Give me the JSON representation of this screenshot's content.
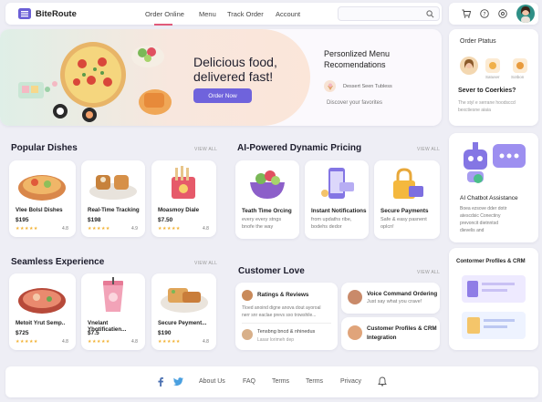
{
  "brand": {
    "name": "BiteRoute"
  },
  "nav": {
    "order_online": "Order Online",
    "menu": "Menu",
    "track_order": "Track Order",
    "account": "Account"
  },
  "hero": {
    "headline_1": "Delicious food,",
    "headline_2": "delivered fast!",
    "button": "Order Now",
    "menu_title_1": "Personlized Menu",
    "menu_title_2": "Recomendations",
    "menu_item": "Dessert Seen Tubless",
    "menu_note": "Discover your favorites"
  },
  "right_panel": {
    "orders_title": "Order Ptatus",
    "avatar_label_1": "Satuser",
    "avatar_label_2": "Sotbon",
    "question": "Sever to Coerkies?",
    "sub_1": "The styl e serrane hoodsccd",
    "sub_2": "bexctiesne aiaia"
  },
  "popular": {
    "title": "Popular Dishes",
    "view_all": "VIEW ALL",
    "items": [
      {
        "name": "Vlee Bolsl Dishes",
        "price": "$195",
        "rating": "4.8"
      },
      {
        "name": "Real-Time Tracking",
        "price": "$198",
        "rating": "4.9"
      },
      {
        "name": "Moasmoy Diale",
        "price": "$7.50",
        "rating": "4.8"
      }
    ]
  },
  "pricing": {
    "title": "AI-Powered Dynamic Pricing",
    "view_all": "VIEW ALL",
    "items": [
      {
        "name": "Teath Time Orcing",
        "desc_1": "every every stngs",
        "desc_2": "bnofe the way"
      },
      {
        "name": "Instant Notifications",
        "desc_1": "from updaths ribe,",
        "desc_2": "bodehs dedor"
      },
      {
        "name": "Secure Payments",
        "desc_1": "Safe & easy pasnent",
        "desc_2": "oplcn!"
      }
    ]
  },
  "chatbot": {
    "title": "AI Chatbot Assistance",
    "desc_1": "Boea ezsove dder dotir",
    "desc_2": "atescdsic Conectiny",
    "desc_3": "prevoncit dietnntsd",
    "desc_4": "dievelis and"
  },
  "seamless": {
    "title": "Seamless Experience",
    "view_all": "VIEW ALL",
    "items": [
      {
        "name": "Metoit Yrut Semp..",
        "price": "$725",
        "rating": "4.8"
      },
      {
        "name": "Vnelant Yhotificatien...",
        "price": "$7.5",
        "rating": "4.8"
      },
      {
        "name": "Secure Peyment...",
        "price": "$190",
        "rating": "4.8"
      }
    ]
  },
  "customer_love": {
    "title": "Customer Love",
    "view_all": "VIEW ALL",
    "review_title": "Ratings & Reviews",
    "review_1": "Tloed anoind digne anova dout ayoroal",
    "review_2": "nerr snr eaclae prevs sxo trowshile...",
    "review_name": "Tensbng bncd & nhinedus",
    "review_role": "Lasar lorimeh dep",
    "voice_title": "Voice Command Ordering",
    "voice_desc": "Just say what you crave!",
    "crm_title_1": "Customer Profiles & CRM",
    "crm_title_2": "Integration"
  },
  "profiles": {
    "title": "Contormer Profiles & CRM"
  },
  "footer": {
    "about": "About Us",
    "faq": "FAQ",
    "terms1": "Terms",
    "terms2": "Terms",
    "privacy": "Privacy"
  }
}
